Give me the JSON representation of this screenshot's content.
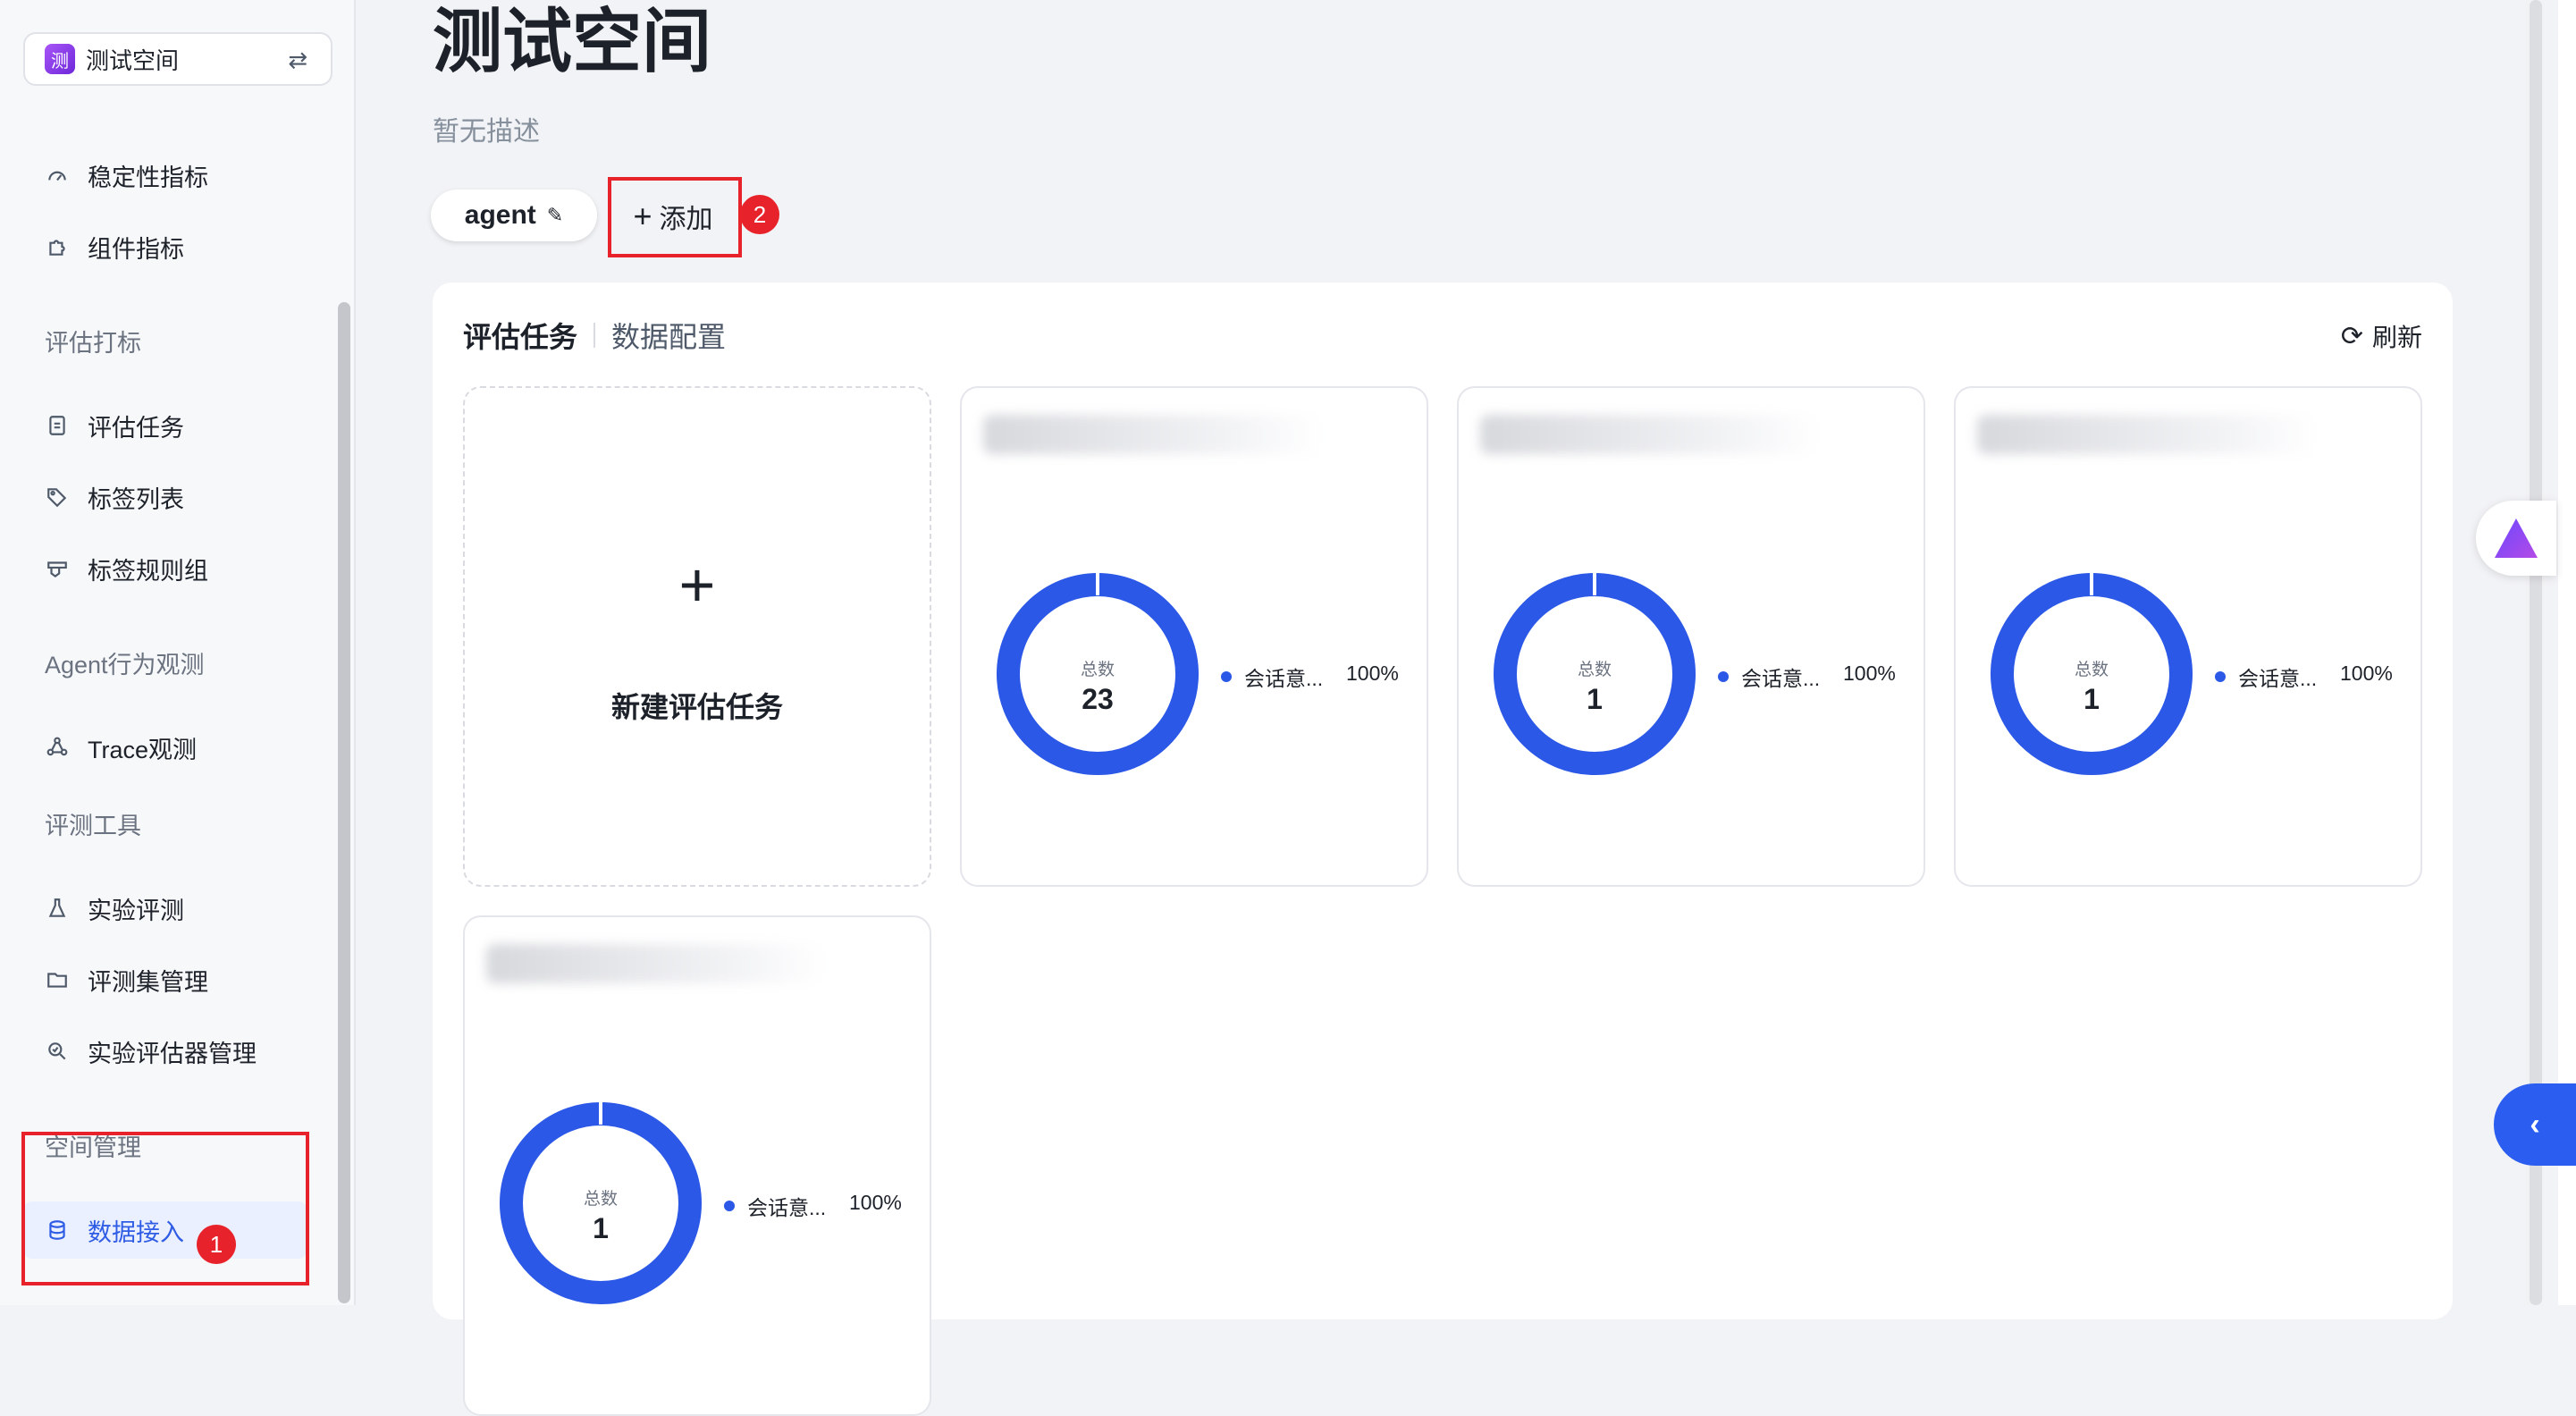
{
  "sidebar": {
    "space_name": "测试空间",
    "space_logo_char": "测",
    "items": [
      {
        "label": "稳定性指标",
        "icon": "gauge-icon"
      },
      {
        "label": "组件指标",
        "icon": "puzzle-icon"
      },
      {
        "group": "评估打标"
      },
      {
        "label": "评估任务",
        "icon": "task-icon"
      },
      {
        "label": "标签列表",
        "icon": "tag-icon"
      },
      {
        "label": "标签规则组",
        "icon": "tag-rules-icon"
      },
      {
        "group": "Agent行为观测"
      },
      {
        "label": "Trace观测",
        "icon": "trace-icon"
      },
      {
        "group": "评测工具"
      },
      {
        "label": "实验评测",
        "icon": "flask-icon"
      },
      {
        "label": "评测集管理",
        "icon": "folder-icon"
      },
      {
        "label": "实验评估器管理",
        "icon": "evaluator-icon"
      },
      {
        "group": "空间管理"
      },
      {
        "label": "数据接入",
        "icon": "database-icon",
        "active": true
      }
    ]
  },
  "annotations": {
    "badge1": "1",
    "badge2": "2"
  },
  "main": {
    "title": "测试空间",
    "description": "暂无描述",
    "tag": "agent",
    "add_label": "添加",
    "tabs": {
      "active": "评估任务",
      "other": "数据配置"
    },
    "refresh_label": "刷新",
    "new_task_label": "新建评估任务",
    "cards": [
      {
        "total_label": "总数",
        "total": "23",
        "legend": "会话意...",
        "percent": "100%"
      },
      {
        "total_label": "总数",
        "total": "1",
        "legend": "会话意...",
        "percent": "100%"
      },
      {
        "total_label": "总数",
        "total": "1",
        "legend": "会话意...",
        "percent": "100%"
      },
      {
        "total_label": "总数",
        "total": "1",
        "legend": "会话意...",
        "percent": "100%"
      }
    ]
  },
  "colors": {
    "accent": "#2b58e6",
    "annotation_red": "#e8222a",
    "active_bg": "#eaf0ff"
  }
}
